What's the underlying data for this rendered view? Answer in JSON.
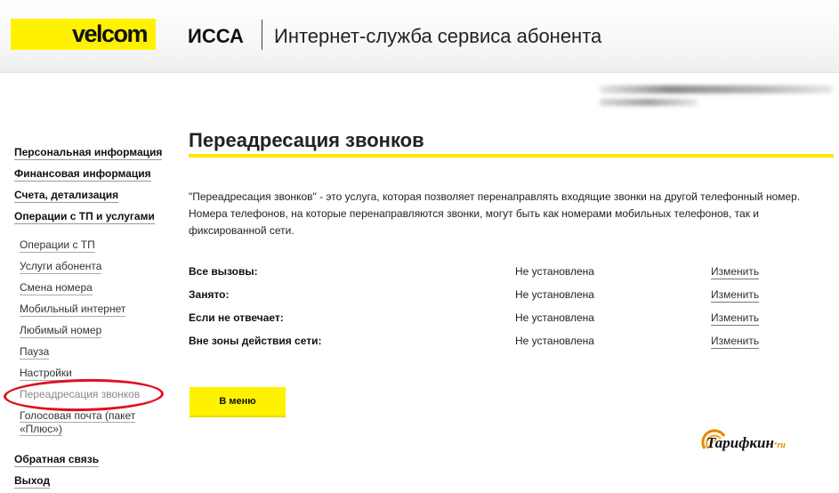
{
  "header": {
    "logo_text": "velcom",
    "app_name": "ИССА",
    "app_subtitle": "Интернет-служба сервиса абонента"
  },
  "sidebar": {
    "main_items": [
      {
        "label": "Персональная информация"
      },
      {
        "label": "Финансовая информация"
      },
      {
        "label": "Счета, детализация"
      },
      {
        "label": "Операции с ТП и услугами"
      }
    ],
    "sub_items": [
      {
        "label": "Операции с ТП"
      },
      {
        "label": "Услуги абонента"
      },
      {
        "label": "Смена номера"
      },
      {
        "label": "Мобильный интернет"
      },
      {
        "label": "Любимый номер"
      },
      {
        "label": "Пауза"
      },
      {
        "label": "Настройки"
      },
      {
        "label": "Переадресация звонков",
        "active": true
      },
      {
        "label": "Голосовая почта (пакет «Плюс»)"
      }
    ],
    "bottom_items": [
      {
        "label": "Обратная связь"
      },
      {
        "label": "Выход"
      }
    ]
  },
  "main": {
    "title": "Переадресация звонков",
    "description": "\"Переадресация звонков\" - это услуга, которая позволяет перенаправлять входящие звонки на другой телефонный номер. Номера телефонов, на которые перенаправляются звонки, могут быть как номерами мобильных телефонов, так и фиксированной сети.",
    "forwarding_rows": [
      {
        "label": "Все вызовы:",
        "status": "Не установлена",
        "action": "Изменить"
      },
      {
        "label": "Занято:",
        "status": "Не установлена",
        "action": "Изменить"
      },
      {
        "label": "Если не отвечает:",
        "status": "Не установлена",
        "action": "Изменить"
      },
      {
        "label": "Вне зоны действия сети:",
        "status": "Не установлена",
        "action": "Изменить"
      }
    ],
    "menu_button": "В меню"
  },
  "watermark": {
    "text": "Тарифкин",
    "domain": "ru"
  },
  "colors": {
    "brand_yellow": "#fff200",
    "title_underline": "#ffe600",
    "highlight_ring": "#e01020",
    "watermark_accent": "#e38a00"
  }
}
